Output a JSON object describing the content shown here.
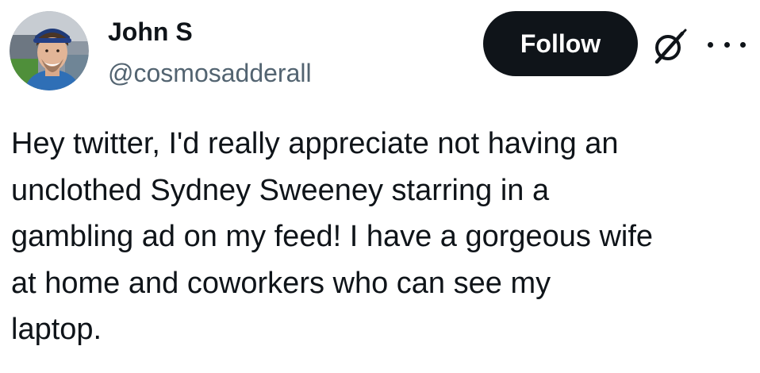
{
  "author": {
    "display_name": "John S",
    "handle": "@cosmosadderall",
    "avatar_icon": "profile-photo"
  },
  "header": {
    "follow_label": "Follow",
    "grok_icon": "grok-icon",
    "more_icon": "more-horizontal-icon"
  },
  "tweet": {
    "text": "Hey twitter, I'd really appreciate not having an\nunclothed Sydney Sweeney starring in a\ngambling ad on my feed! I have a gorgeous wife\nat home and coworkers who can see my\nlaptop."
  },
  "colors": {
    "text_primary": "#0f1419",
    "text_secondary": "#536471",
    "button_bg": "#0f1419",
    "button_text": "#ffffff"
  }
}
